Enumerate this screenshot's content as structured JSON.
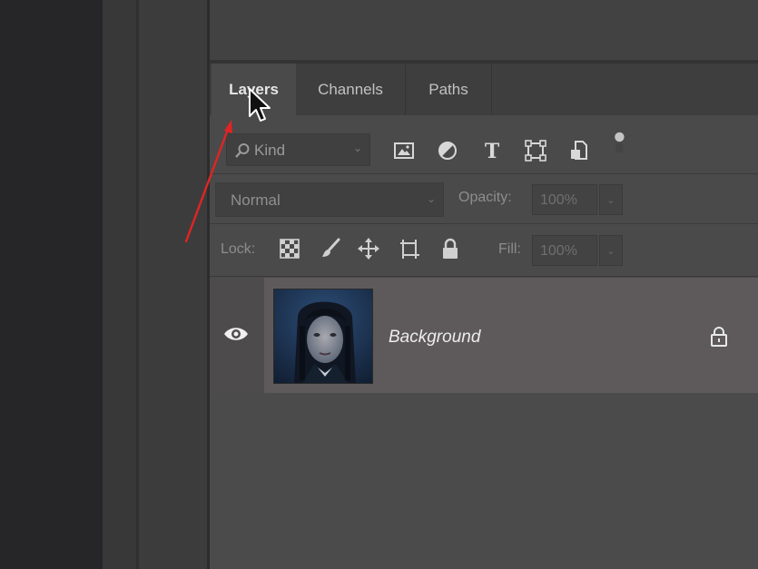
{
  "tabs": [
    {
      "label": "Layers",
      "active": true
    },
    {
      "label": "Channels",
      "active": false
    },
    {
      "label": "Paths",
      "active": false
    }
  ],
  "filter": {
    "kind_label": "Kind",
    "icons": [
      "image-filter-icon",
      "adjustment-filter-icon",
      "type-filter-icon",
      "shape-filter-icon",
      "smart-object-filter-icon",
      "filter-toggle-icon"
    ]
  },
  "blend": {
    "mode": "Normal",
    "opacity_label": "Opacity:",
    "opacity_value": "100%"
  },
  "lock": {
    "label": "Lock:",
    "icons": [
      "lock-transparent-pixels-icon",
      "lock-image-pixels-icon",
      "lock-position-icon",
      "lock-artboard-icon",
      "lock-all-icon"
    ],
    "fill_label": "Fill:",
    "fill_value": "100%"
  },
  "layers": [
    {
      "name": "Background",
      "visible": true,
      "locked": true
    }
  ],
  "colors": {
    "panel_bg": "#4a4a4a",
    "selected_layer_bg": "#5e5a5c",
    "annotation_arrow": "#e02424"
  }
}
